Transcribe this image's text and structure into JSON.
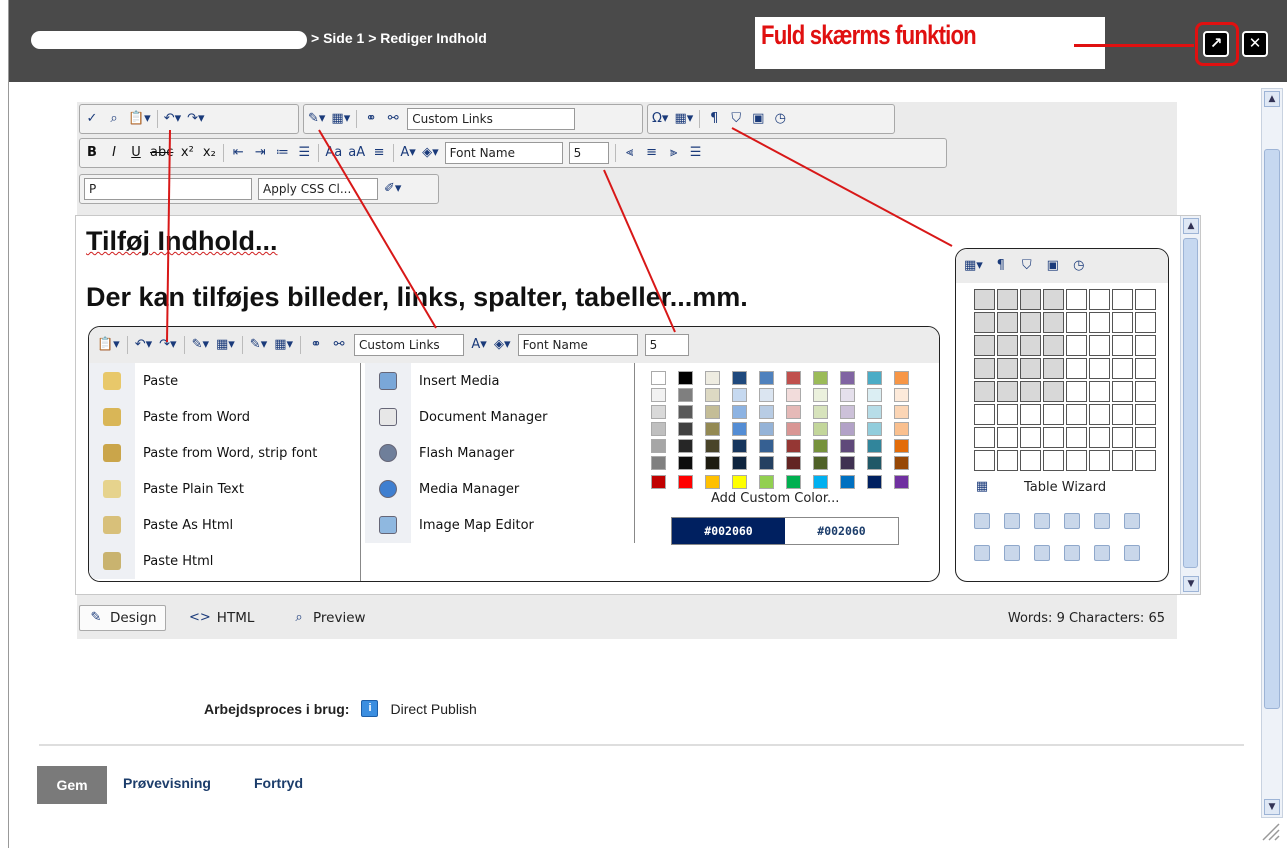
{
  "titlebar": {
    "breadcrumb": "> Side 1 > Rediger Indhold",
    "annotation": "Fuld skærms funktion",
    "fullscreen_icon": "expand-arrow-icon",
    "close_icon": "close-x-icon"
  },
  "toolbar": {
    "custom_links": "Custom Links",
    "font_name": "Font Name",
    "font_size": "5",
    "paragraph": "P",
    "css_class": "Apply CSS Cl..."
  },
  "content": {
    "line1": "Tilføj Indhold...",
    "line2": "Der kan tilføjes billeder, links, spalter, tabeller...mm."
  },
  "inset_toolbar": {
    "custom_links": "Custom Links",
    "font_name": "Font Name",
    "font_size": "5"
  },
  "paste_menu": [
    {
      "label": "Paste",
      "icon": "paste-icon"
    },
    {
      "label": "Paste from Word",
      "icon": "paste-word-icon"
    },
    {
      "label": "Paste from Word, strip font",
      "icon": "paste-word-strip-icon"
    },
    {
      "label": "Paste Plain Text",
      "icon": "paste-text-icon"
    },
    {
      "label": "Paste As Html",
      "icon": "paste-as-html-icon"
    },
    {
      "label": "Paste Html",
      "icon": "paste-html-icon"
    }
  ],
  "media_menu": [
    {
      "label": "Insert Media",
      "icon": "insert-media-icon"
    },
    {
      "label": "Document Manager",
      "icon": "document-manager-icon"
    },
    {
      "label": "Flash Manager",
      "icon": "flash-manager-icon"
    },
    {
      "label": "Media Manager",
      "icon": "media-manager-icon"
    },
    {
      "label": "Image Map Editor",
      "icon": "image-map-icon"
    }
  ],
  "palette": {
    "add_custom": "Add Custom Color...",
    "hex_selected": "#002060",
    "hex_input": "#002060",
    "columns": [
      [
        "#ffffff",
        "#f2f2f2",
        "#d9d9d9",
        "#bfbfbf",
        "#a6a6a6",
        "#808080"
      ],
      [
        "#000000",
        "#7f7f7f",
        "#595959",
        "#404040",
        "#262626",
        "#0d0d0d"
      ],
      [
        "#eeece1",
        "#ddd9c3",
        "#c4bd97",
        "#938953",
        "#494429",
        "#1d1b10"
      ],
      [
        "#1f497d",
        "#c6d9f0",
        "#8db3e2",
        "#548dd4",
        "#17365d",
        "#0f243e"
      ],
      [
        "#4f81bd",
        "#dbe5f1",
        "#b8cce4",
        "#95b3d7",
        "#366092",
        "#244061"
      ],
      [
        "#c0504d",
        "#f2dcdb",
        "#e5b9b7",
        "#d99694",
        "#953734",
        "#632423"
      ],
      [
        "#9bbb59",
        "#ebf1dd",
        "#d7e3bc",
        "#c3d69b",
        "#76923c",
        "#4f6128"
      ],
      [
        "#8064a2",
        "#e5e0ec",
        "#ccc1d9",
        "#b2a2c7",
        "#5f497a",
        "#3f3151"
      ],
      [
        "#4bacc6",
        "#dbeef3",
        "#b7dde8",
        "#92cddc",
        "#31859b",
        "#205867"
      ],
      [
        "#f79646",
        "#fdeada",
        "#fbd5b5",
        "#fac08f",
        "#e36c09",
        "#974806"
      ]
    ],
    "standard": [
      "#c00000",
      "#ff0000",
      "#ffc000",
      "#ffff00",
      "#92d050",
      "#00b050",
      "#00b0f0",
      "#0070c0",
      "#002060",
      "#7030a0"
    ]
  },
  "table_popup": {
    "wizard": "Table Wizard"
  },
  "modes": {
    "design": "Design",
    "html": "HTML",
    "preview": "Preview",
    "counts": "Words: 9   Characters: 65"
  },
  "workflow": {
    "label": "Arbejdsproces i brug:",
    "value": "Direct Publish"
  },
  "footer": {
    "save": "Gem",
    "preview": "Prøvevisning",
    "cancel": "Fortryd"
  },
  "colors": {
    "annotation": "#e01010",
    "titlebar": "#4a4a4a",
    "link": "#1c3d6b"
  }
}
